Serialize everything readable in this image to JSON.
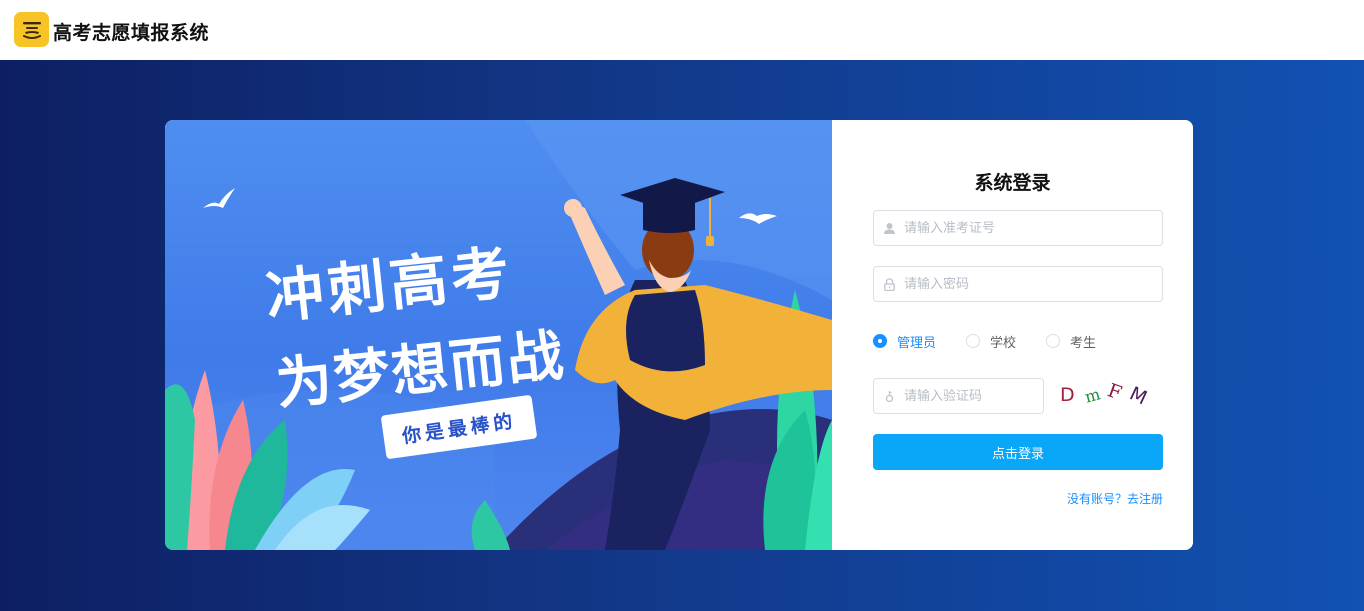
{
  "app": {
    "title": "高考志愿填报系统"
  },
  "hero": {
    "line1": "冲刺高考",
    "line2": "为梦想而战",
    "badge": "你是最棒的"
  },
  "login": {
    "title": "系统登录",
    "username_placeholder": "请输入准考证号",
    "password_placeholder": "请输入密码",
    "captcha_placeholder": "请输入验证码",
    "roles": [
      {
        "label": "管理员",
        "selected": true
      },
      {
        "label": "学校",
        "selected": false
      },
      {
        "label": "考生",
        "selected": false
      }
    ],
    "captcha_chars": [
      "D",
      "m",
      "F",
      "M"
    ],
    "captcha_colors": [
      "#a0213a",
      "#1f8a3a",
      "#8e1a3c",
      "#4a1a5c"
    ],
    "submit_label": "点击登录",
    "register_link": "没有账号？去注册"
  },
  "colors": {
    "primary": "#0aa7f8",
    "link": "#1890ff",
    "logo": "#f7c325"
  }
}
